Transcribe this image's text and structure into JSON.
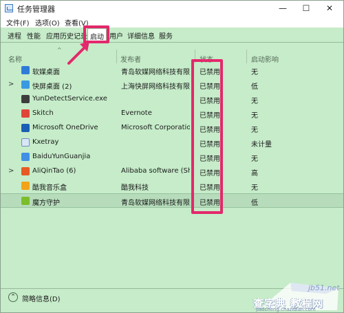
{
  "window": {
    "title": "任务管理器",
    "close_glyph": "✕",
    "max_glyph": "☐",
    "min_glyph": "—"
  },
  "menu": [
    {
      "label": "文件(F)"
    },
    {
      "label": "选项(O)"
    },
    {
      "label": "查看(V)"
    }
  ],
  "tabs": [
    {
      "label": "进程"
    },
    {
      "label": "性能"
    },
    {
      "label": "应用历史记录"
    },
    {
      "label": "启动",
      "active": true
    },
    {
      "label": "用户"
    },
    {
      "label": "详细信息"
    },
    {
      "label": "服务"
    }
  ],
  "columns": {
    "name": "名称",
    "publisher": "发布者",
    "status": "状态",
    "impact": "启动影响"
  },
  "rows": [
    {
      "name": "软媒桌面",
      "publisher": "青岛软媒网络科技有限...",
      "status": "已禁用",
      "impact": "无",
      "expandable": false,
      "icon": "ruanmei-icon",
      "icon_color": "#2f7bd8"
    },
    {
      "name": "快屏桌面 (2)",
      "publisher": "上海快屏网络科技有限...",
      "status": "已禁用",
      "impact": "低",
      "expandable": true,
      "icon": "kuaiping-icon",
      "icon_color": "#3a9ae0"
    },
    {
      "name": "YunDetectService.exe",
      "publisher": "",
      "status": "已禁用",
      "impact": "无",
      "expandable": false,
      "icon": "exe-icon",
      "icon_color": "#3d3d3d"
    },
    {
      "name": "Skitch",
      "publisher": "Evernote",
      "status": "已禁用",
      "impact": "无",
      "expandable": false,
      "icon": "skitch-icon",
      "icon_color": "#e0453a"
    },
    {
      "name": "Microsoft OneDrive",
      "publisher": "Microsoft Corporation",
      "status": "已禁用",
      "impact": "无",
      "expandable": false,
      "icon": "onedrive-icon",
      "icon_color": "#1a5fb4"
    },
    {
      "name": "Kxetray",
      "publisher": "",
      "status": "已禁用",
      "impact": "未计量",
      "expandable": false,
      "icon": "kxetray-icon",
      "icon_color": "#d9e6f5"
    },
    {
      "name": "BaiduYunGuanjia",
      "publisher": "",
      "status": "已禁用",
      "impact": "无",
      "expandable": false,
      "icon": "baiduyun-icon",
      "icon_color": "#3f8fe5"
    },
    {
      "name": "AliQinTao (6)",
      "publisher": "Alibaba software (Sha...",
      "status": "已禁用",
      "impact": "高",
      "expandable": true,
      "icon": "aliqintao-icon",
      "icon_color": "#e65a24"
    },
    {
      "name": "酷我音乐盒",
      "publisher": "酷我科技",
      "status": "已禁用",
      "impact": "无",
      "expandable": false,
      "icon": "kuwo-icon",
      "icon_color": "#f2a31a"
    },
    {
      "name": "魔方守护",
      "publisher": "青岛软媒网络科技有限...",
      "status": "已禁用",
      "impact": "低",
      "expandable": false,
      "icon": "mofang-icon",
      "icon_color": "#7bbd2a",
      "selected": true
    }
  ],
  "footer": {
    "label": "简略信息(D)",
    "icon_glyph": "⌃"
  },
  "watermark": {
    "site": "jb51.net",
    "label": "查字典 教程网",
    "url": "jiaocheng.chazidian.com"
  },
  "colors": {
    "highlight": "#e3286b",
    "background": "#c6ecc9"
  }
}
